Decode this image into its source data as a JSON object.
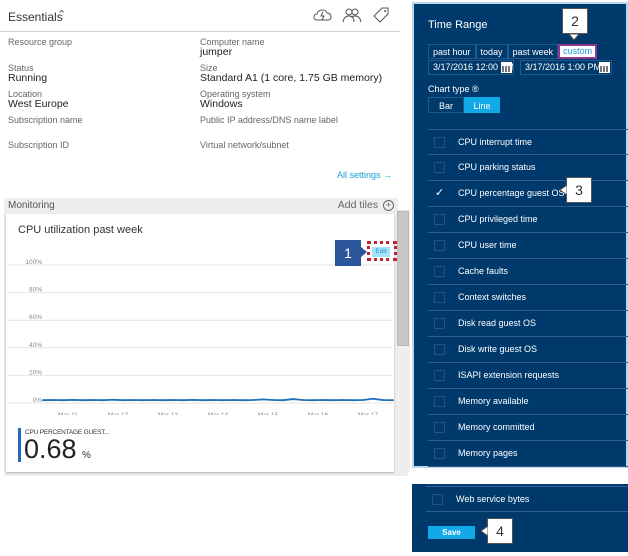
{
  "essentials": {
    "title": "Essentials",
    "chevron": "^",
    "icons": [
      "connect-icon",
      "users-icon",
      "tag-icon"
    ],
    "left_props": [
      {
        "label": "Resource group",
        "value": ""
      },
      {
        "label": "Status",
        "value": "Running"
      },
      {
        "label": "Location",
        "value": "West Europe"
      },
      {
        "label": "Subscription name",
        "value": ""
      },
      {
        "label": "Subscription ID",
        "value": ""
      }
    ],
    "right_props": [
      {
        "label": "Computer name",
        "value": "jumper"
      },
      {
        "label": "Size",
        "value": "Standard A1 (1 core, 1.75 GB memory)"
      },
      {
        "label": "Operating system",
        "value": "Windows"
      },
      {
        "label": "Public IP address/DNS name label",
        "value": ""
      },
      {
        "label": "Virtual network/subnet",
        "value": ""
      }
    ],
    "all_settings": "All settings →"
  },
  "monitoring": {
    "title": "Monitoring",
    "add_tiles": "Add tiles",
    "add_icon": "+",
    "tile": {
      "title": "CPU utilization past week",
      "edit_label": "Edit",
      "metric_label": "CPU PERCENTAGE GUEST...",
      "metric_value": "0.68",
      "metric_unit": "%"
    }
  },
  "chart_data": {
    "type": "line",
    "title": "CPU utilization past week",
    "xlabel": "",
    "ylabel": "",
    "ylim": [
      0,
      100
    ],
    "y_ticks": [
      "100%",
      "80%",
      "60%",
      "40%",
      "20%",
      "0%"
    ],
    "y_tick_values": [
      100,
      80,
      60,
      40,
      20,
      0
    ],
    "categories": [
      "Mar 11",
      "Mar 12",
      "Mar 13",
      "Mar 14",
      "Mar 15",
      "Mar 16",
      "Mar 17"
    ],
    "grid": true,
    "series": [
      {
        "name": "CPU percentage guest OS",
        "color": "#1e6fb8",
        "x": [
          10.5,
          10.7,
          10.9,
          11.1,
          11.3,
          11.5,
          11.7,
          11.9,
          12.1,
          12.3,
          12.5,
          12.7,
          12.9,
          13.1,
          13.3,
          13.5,
          13.7,
          13.9,
          14.1,
          14.3,
          14.5,
          14.7,
          14.9,
          15.1,
          15.3,
          15.5,
          15.7,
          15.9,
          16.1,
          16.3,
          16.5,
          16.7,
          16.9,
          17.1,
          17.3,
          17.5
        ],
        "values": [
          0.6,
          0.7,
          0.6,
          0.8,
          0.6,
          0.7,
          0.6,
          0.9,
          0.6,
          0.7,
          0.6,
          0.7,
          0.6,
          0.7,
          0.6,
          0.8,
          0.6,
          0.7,
          0.6,
          0.7,
          0.6,
          0.7,
          1.2,
          0.7,
          0.6,
          1.4,
          0.7,
          0.6,
          0.7,
          0.6,
          0.7,
          0.6,
          0.7,
          1.6,
          0.7,
          0.6
        ]
      }
    ],
    "legend": "bottom-left"
  },
  "time_range": {
    "title": "Time Range",
    "tabs": [
      "past hour",
      "today",
      "past week",
      "custom"
    ],
    "active_tab": "custom",
    "start": "3/17/2016 12:00 PM",
    "end": "3/17/2016 1:00 PM",
    "chart_type_label": "Chart type ®",
    "chart_types": [
      "Bar",
      "Line"
    ],
    "active_chart_type": "Line"
  },
  "metrics": [
    {
      "name": "CPU interrupt time",
      "checked": false
    },
    {
      "name": "CPU parking status",
      "checked": false
    },
    {
      "name": "CPU percentage guest OS",
      "checked": true
    },
    {
      "name": "CPU privileged time",
      "checked": false
    },
    {
      "name": "CPU user time",
      "checked": false
    },
    {
      "name": "Cache faults",
      "checked": false
    },
    {
      "name": "Context switches",
      "checked": false
    },
    {
      "name": "Disk read guest OS",
      "checked": false
    },
    {
      "name": "Disk write guest OS",
      "checked": false
    },
    {
      "name": "ISAPI extension requests",
      "checked": false
    },
    {
      "name": "Memory available",
      "checked": false
    },
    {
      "name": "Memory committed",
      "checked": false
    },
    {
      "name": "Memory pages",
      "checked": false
    }
  ],
  "bottom_metric": {
    "name": "Web service bytes",
    "checked": false
  },
  "save_label": "Save",
  "callouts": [
    "1",
    "2",
    "3",
    "4"
  ],
  "colors": {
    "panel_bg": "#003a6c",
    "accent": "#12a9e8",
    "link": "#1a9bd7",
    "highlight_dash": "#c0232c",
    "callout_blue": "#2b579a"
  }
}
